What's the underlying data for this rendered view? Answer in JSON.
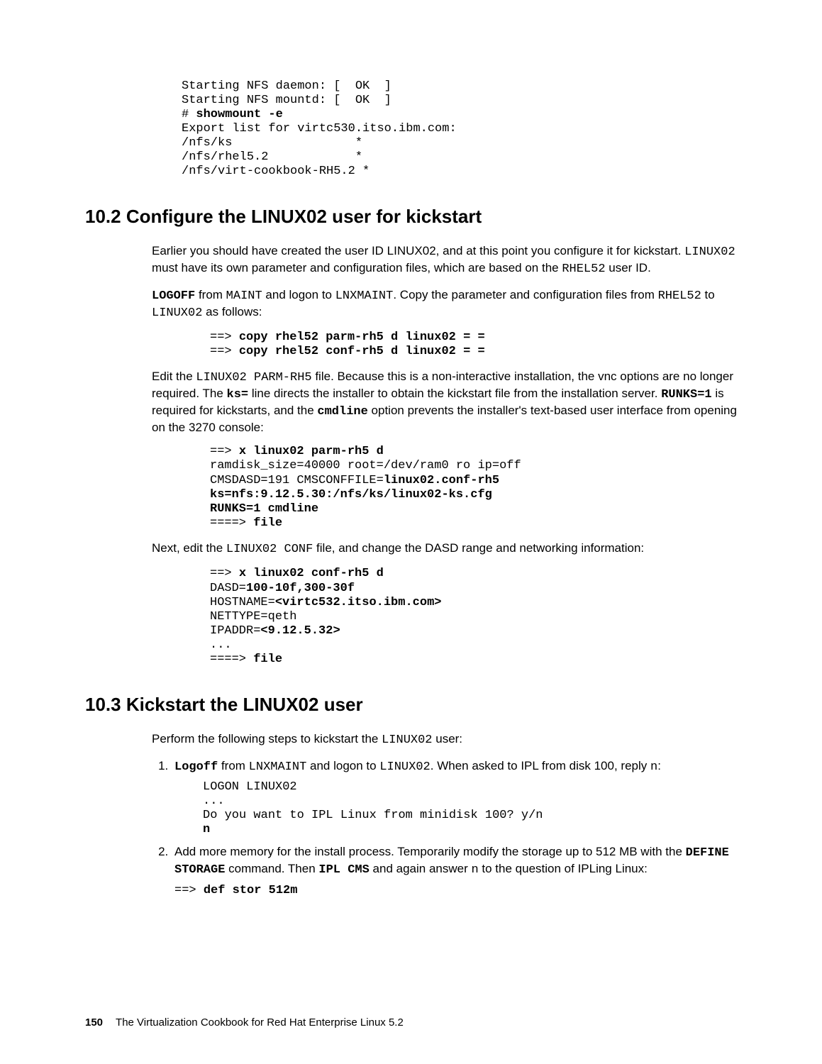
{
  "code1": {
    "l1": "Starting NFS daemon: [  OK  ]",
    "l2": "Starting NFS mountd: [  OK  ]",
    "l3p": "# ",
    "l3b": "showmount -e",
    "l4": "Export list for virtc530.itso.ibm.com:",
    "l5": "/nfs/ks                 *",
    "l6": "/nfs/rhel5.2            *",
    "l7": "/nfs/virt-cookbook-RH5.2 *"
  },
  "sec102": {
    "heading": "10.2  Configure the LINUX02 user for kickstart",
    "p1a": "Earlier you should have created the user ID LINUX02, and at this point you configure it for kickstart. ",
    "p1m1": "LINUX02",
    "p1b": " must have its own parameter and configuration files, which are based on the ",
    "p1m2": "RHEL52",
    "p1c": " user ID.",
    "p2b1": "LOGOFF",
    "p2a": " from ",
    "p2m1": "MAINT",
    "p2b": " and logon to ",
    "p2m2": "LNXMAINT",
    "p2c": ". Copy the parameter and configuration files from ",
    "p2m3": "RHEL52",
    "p2d": " to ",
    "p2m4": "LINUX02",
    "p2e": " as follows:",
    "code2": {
      "l1p": "==> ",
      "l1b": "copy rhel52 parm-rh5 d linux02 = =",
      "l2p": "==> ",
      "l2b": "copy rhel52 conf-rh5 d linux02 = ="
    },
    "p3a": "Edit the ",
    "p3m1": "LINUX02 PARM-RH5",
    "p3b": " file. Because this is a non-interactive installation, the vnc options are no longer required. The ",
    "p3b1": "ks=",
    "p3c": " line directs the installer to obtain the kickstart file from the installation server. ",
    "p3b2": "RUNKS=1",
    "p3d": " is required for kickstarts, and the ",
    "p3b3": "cmdline",
    "p3e": " option prevents the installer's text-based user interface from opening on the 3270 console:",
    "code3": {
      "l1p": "==> ",
      "l1b": "x linux02 parm-rh5 d",
      "l2": "ramdisk_size=40000 root=/dev/ram0 ro ip=off",
      "l3a": "CMSDASD=191 CMSCONFFILE=",
      "l3b": "linux02.conf-rh5",
      "l4b": "ks=nfs:9.12.5.30:/nfs/ks/linux02-ks.cfg",
      "l5b": "RUNKS=1 cmdline",
      "l6p": "====> ",
      "l6b": "file"
    },
    "p4a": "Next, edit the  ",
    "p4m1": "LINUX02 CONF",
    "p4b": " file, and change the DASD range and networking information:",
    "code4": {
      "l1p": "==> ",
      "l1b": "x linux02 conf-rh5 d",
      "l2a": "DASD=",
      "l2b": "100-10f,300-30f",
      "l3a": "HOSTNAME=",
      "l3b": "<virtc532.itso.ibm.com>",
      "l4": "NETTYPE=qeth",
      "l5a": "IPADDR=",
      "l5b": "<9.12.5.32>",
      "l6": "...",
      "l7p": "====> ",
      "l7b": "file"
    }
  },
  "sec103": {
    "heading": "10.3  Kickstart the LINUX02 user",
    "p1a": "Perform the following steps to kickstart the ",
    "p1m1": "LINUX02",
    "p1b": " user:",
    "step1": {
      "b1": "Logoff",
      "t1": " from ",
      "m1": "LNXMAINT",
      "t2": " and logon to ",
      "m2": "LINUX02",
      "t3": ". When asked to IPL from disk 100, reply ",
      "m3": "n",
      "t4": ":",
      "code": {
        "l1": "LOGON LINUX02",
        "l2": "...",
        "l3": "Do you want to IPL Linux from minidisk 100? y/n",
        "l4b": "n"
      }
    },
    "step2": {
      "t1": "Add more memory for the install process. Temporarily modify the storage up to 512 MB with the ",
      "b1": "DEFINE STORAGE",
      "t2": " command. Then ",
      "b2": "IPL CMS",
      "t3": " and again answer ",
      "m1": "n",
      "t4": " to the question of IPLing Linux:",
      "code": {
        "l1p": "==> ",
        "l1b": "def stor 512m"
      }
    }
  },
  "footer": {
    "page": "150",
    "title": "The Virtualization Cookbook for Red Hat Enterprise Linux 5.2"
  }
}
